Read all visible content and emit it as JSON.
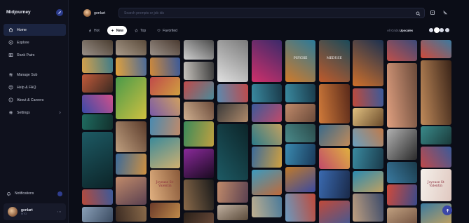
{
  "app": {
    "brand": "Midjourney"
  },
  "sidebar": {
    "items": [
      {
        "label": "Home",
        "icon": "home-icon",
        "active": true
      },
      {
        "label": "Explore",
        "icon": "compass-icon",
        "active": false
      },
      {
        "label": "Rank Pairs",
        "icon": "rank-pairs-icon",
        "active": false
      },
      {
        "label": "Manage Sub",
        "icon": "manage-sub-icon",
        "active": false
      },
      {
        "label": "Help & FAQ",
        "icon": "help-icon",
        "active": false
      },
      {
        "label": "About & Careers",
        "icon": "info-icon",
        "active": false
      },
      {
        "label": "Settings",
        "icon": "settings-icon",
        "active": false
      }
    ],
    "notifications_label": "Notifications",
    "user": {
      "name": "genlart",
      "sub": "MTO"
    }
  },
  "header": {
    "username": "genlart",
    "search_placeholder": "Search prompts or job ids"
  },
  "tabs": [
    {
      "label": "Hot",
      "icon": "fire-icon",
      "active": false
    },
    {
      "label": "New",
      "icon": "sparkle-icon",
      "active": true
    },
    {
      "label": "Top",
      "icon": "star-icon",
      "active": false
    },
    {
      "label": "Favorited",
      "icon": "heart-icon",
      "active": false
    }
  ],
  "sort": {
    "label": "All Grids",
    "value": "Upscales"
  },
  "colors": {
    "accent": "#3b47a8",
    "active_nav": "#1b2440",
    "background": "#0b0d17"
  },
  "gallery": {
    "columns": [
      [
        {
          "h": 22,
          "c": "#9a9088",
          "c2": "#4a3d30"
        },
        {
          "h": 22,
          "c": "#d7a14a",
          "c2": "#3e7c8a"
        },
        {
          "h": 26,
          "c": "#c25a3a",
          "c2": "#3a2a22"
        },
        {
          "h": 26,
          "c": "#3a4aa8",
          "c2": "#d0508a"
        },
        {
          "h": 22,
          "c": "#1f6b60",
          "c2": "#12302c"
        },
        {
          "h": 80,
          "c": "#1d5a64",
          "c2": "#0c2428"
        },
        {
          "h": 22,
          "c": "#b84a3a",
          "c2": "#3b5a9a"
        },
        {
          "h": 22,
          "c": "#8aa0b8",
          "c2": "#3a4a60"
        }
      ],
      [
        {
          "h": 22,
          "c": "#a89a8a",
          "c2": "#5a4a3a"
        },
        {
          "h": 26,
          "c": "#e4a23a",
          "c2": "#4a6a9a"
        },
        {
          "h": 60,
          "c": "#4a9a4a",
          "c2": "#d0c040"
        },
        {
          "h": 44,
          "c": "#c0a080",
          "c2": "#5a3a2a"
        },
        {
          "h": 30,
          "c": "#3a6a9a",
          "c2": "#d09040"
        },
        {
          "h": 40,
          "c": "#c08a6a",
          "c2": "#5a4050"
        },
        {
          "h": 22,
          "c": "#3a2a22",
          "c2": "#8a6a4a"
        }
      ],
      [
        {
          "h": 22,
          "c": "#9a9088",
          "c2": "#4a3a30"
        },
        {
          "h": 26,
          "c": "#d08a3a",
          "c2": "#3a5a9a"
        },
        {
          "h": 26,
          "c": "#c04a4a",
          "c2": "#d0a040"
        },
        {
          "h": 26,
          "c": "#7a5aa8",
          "c2": "#d0a060"
        },
        {
          "h": 26,
          "c": "#4a8ab0",
          "c2": "#c08a6a"
        },
        {
          "h": 44,
          "c": "#3a8a9a",
          "c2": "#d0b070"
        },
        {
          "h": 44,
          "c": "#e0b080",
          "c2": "#8a5a3a",
          "text": "Joyeuse St-Valentin"
        },
        {
          "h": 22,
          "c": "#6a3a2a",
          "c2": "#c08a4a"
        }
      ],
      [
        {
          "h": 28,
          "c": "#d0d0d0",
          "c2": "#4a4a4a"
        },
        {
          "h": 26,
          "c": "#c8c4be",
          "c2": "#3a3a3a"
        },
        {
          "h": 26,
          "c": "#c04a4a",
          "c2": "#4a8a9a"
        },
        {
          "h": 26,
          "c": "#d0b090",
          "c2": "#6a4a3a"
        },
        {
          "h": 36,
          "c": "#3a8a5a",
          "c2": "#c0a040"
        },
        {
          "h": 42,
          "c": "#8a2a9a",
          "c2": "#1a0a20"
        },
        {
          "h": 44,
          "c": "#8a6a4a",
          "c2": "#1a1a1a"
        },
        {
          "h": 22,
          "c": "#2a2018",
          "c2": "#6a4a3a"
        }
      ],
      [
        {
          "h": 60,
          "c": "#e0e0e0",
          "c2": "#7a7a7a"
        },
        {
          "h": 26,
          "c": "#5a8ab0",
          "c2": "#c04a4a"
        },
        {
          "h": 26,
          "c": "#3a3a3a",
          "c2": "#b08a6a"
        },
        {
          "h": 80,
          "c": "#1d5a64",
          "c2": "#0c2428"
        },
        {
          "h": 30,
          "c": "#c08a6a",
          "c2": "#5a4050"
        },
        {
          "h": 22,
          "c": "#c0b0a0",
          "c2": "#5a4a3a"
        }
      ],
      [
        {
          "h": 60,
          "c": "#d0306a",
          "c2": "#3a2a6a"
        },
        {
          "h": 26,
          "c": "#3a8aa0",
          "c2": "#1a3a4a"
        },
        {
          "h": 26,
          "c": "#3a5a9a",
          "c2": "#c04a6a"
        },
        {
          "h": 30,
          "c": "#2a7a8a",
          "c2": "#c0a060"
        },
        {
          "h": 30,
          "c": "#3a6a9a",
          "c2": "#d0a040"
        },
        {
          "h": 36,
          "c": "#3a9ac0",
          "c2": "#c06a3a"
        },
        {
          "h": 30,
          "c": "#c0b090",
          "c2": "#4a7a9a"
        }
      ],
      [
        {
          "h": 60,
          "c": "#d07a2a",
          "c2": "#2a7a9a",
          "text": "PSYCHE"
        },
        {
          "h": 26,
          "c": "#3a8aa0",
          "c2": "#1a3a4a"
        },
        {
          "h": 26,
          "c": "#c08a6a",
          "c2": "#6a4a3a"
        },
        {
          "h": 26,
          "c": "#4a8a8a",
          "c2": "#2a4a4a"
        },
        {
          "h": 30,
          "c": "#3a8ab0",
          "c2": "#1a3a5a"
        },
        {
          "h": 36,
          "c": "#c07a2a",
          "c2": "#3a4aa0"
        },
        {
          "h": 40,
          "c": "#6a9ac0",
          "c2": "#c04a3a"
        }
      ],
      [
        {
          "h": 60,
          "c": "#c05a2a",
          "c2": "#1a4a5a",
          "text": "MEDUSE"
        },
        {
          "h": 56,
          "c": "#d07a3a",
          "c2": "#5a2a1a"
        },
        {
          "h": 30,
          "c": "#3a6a8a",
          "c2": "#c08a5a"
        },
        {
          "h": 30,
          "c": "#c04a6a",
          "c2": "#e0b040"
        },
        {
          "h": 40,
          "c": "#3a6ab0",
          "c2": "#1a2a4a"
        },
        {
          "h": 40,
          "c": "#c04a3a",
          "c2": "#3a5a9a"
        }
      ],
      [
        {
          "h": 66,
          "c": "#d0702a",
          "c2": "#1a3050"
        },
        {
          "h": 26,
          "c": "#c04a3a",
          "c2": "#3a5a9a"
        },
        {
          "h": 26,
          "c": "#e0c080",
          "c2": "#6a4a2a"
        },
        {
          "h": 26,
          "c": "#6aa0c0",
          "c2": "#c07a4a"
        },
        {
          "h": 30,
          "c": "#3a8aa0",
          "c2": "#1a3a4a"
        },
        {
          "h": 30,
          "c": "#2a8ab0",
          "c2": "#c0a060"
        },
        {
          "h": 40,
          "c": "#c0a080",
          "c2": "#3a4a6a"
        }
      ],
      [
        {
          "h": 30,
          "c": "#c0504a",
          "c2": "#3a4a7a"
        },
        {
          "h": 92,
          "c": "#e0a080",
          "c2": "#6a4a3a"
        },
        {
          "h": 44,
          "c": "#b0b0b0",
          "c2": "#2a2a2a"
        },
        {
          "h": 30,
          "c": "#3a7aa0",
          "c2": "#1a3a4a"
        },
        {
          "h": 30,
          "c": "#d04a3a",
          "c2": "#3a4a8a"
        },
        {
          "h": 30,
          "c": "#c0a080",
          "c2": "#6a4a3a"
        }
      ],
      [
        {
          "h": 26,
          "c": "#d04a3a",
          "c2": "#3a7aa0"
        },
        {
          "h": 92,
          "c": "#c08a5a",
          "c2": "#3a2418"
        },
        {
          "h": 26,
          "c": "#3a8a8a",
          "c2": "#1a3a3a"
        },
        {
          "h": 30,
          "c": "#c04a4a",
          "c2": "#3a5a9a"
        },
        {
          "h": 46,
          "c": "#f4f0ea",
          "c2": "#e0c8c0",
          "text": "Joyeuse St Valentin"
        },
        {
          "h": 30,
          "c": "#3a7aa0",
          "c2": "#c0a060"
        }
      ]
    ]
  }
}
